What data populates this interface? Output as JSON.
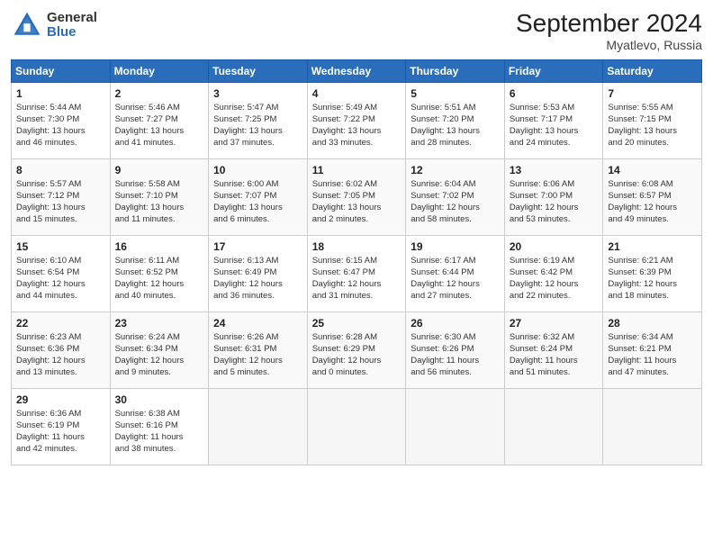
{
  "header": {
    "logo_general": "General",
    "logo_blue": "Blue",
    "month_title": "September 2024",
    "location": "Myatlevo, Russia"
  },
  "weekdays": [
    "Sunday",
    "Monday",
    "Tuesday",
    "Wednesday",
    "Thursday",
    "Friday",
    "Saturday"
  ],
  "weeks": [
    [
      {
        "day": "1",
        "info": "Sunrise: 5:44 AM\nSunset: 7:30 PM\nDaylight: 13 hours\nand 46 minutes."
      },
      {
        "day": "2",
        "info": "Sunrise: 5:46 AM\nSunset: 7:27 PM\nDaylight: 13 hours\nand 41 minutes."
      },
      {
        "day": "3",
        "info": "Sunrise: 5:47 AM\nSunset: 7:25 PM\nDaylight: 13 hours\nand 37 minutes."
      },
      {
        "day": "4",
        "info": "Sunrise: 5:49 AM\nSunset: 7:22 PM\nDaylight: 13 hours\nand 33 minutes."
      },
      {
        "day": "5",
        "info": "Sunrise: 5:51 AM\nSunset: 7:20 PM\nDaylight: 13 hours\nand 28 minutes."
      },
      {
        "day": "6",
        "info": "Sunrise: 5:53 AM\nSunset: 7:17 PM\nDaylight: 13 hours\nand 24 minutes."
      },
      {
        "day": "7",
        "info": "Sunrise: 5:55 AM\nSunset: 7:15 PM\nDaylight: 13 hours\nand 20 minutes."
      }
    ],
    [
      {
        "day": "8",
        "info": "Sunrise: 5:57 AM\nSunset: 7:12 PM\nDaylight: 13 hours\nand 15 minutes."
      },
      {
        "day": "9",
        "info": "Sunrise: 5:58 AM\nSunset: 7:10 PM\nDaylight: 13 hours\nand 11 minutes."
      },
      {
        "day": "10",
        "info": "Sunrise: 6:00 AM\nSunset: 7:07 PM\nDaylight: 13 hours\nand 6 minutes."
      },
      {
        "day": "11",
        "info": "Sunrise: 6:02 AM\nSunset: 7:05 PM\nDaylight: 13 hours\nand 2 minutes."
      },
      {
        "day": "12",
        "info": "Sunrise: 6:04 AM\nSunset: 7:02 PM\nDaylight: 12 hours\nand 58 minutes."
      },
      {
        "day": "13",
        "info": "Sunrise: 6:06 AM\nSunset: 7:00 PM\nDaylight: 12 hours\nand 53 minutes."
      },
      {
        "day": "14",
        "info": "Sunrise: 6:08 AM\nSunset: 6:57 PM\nDaylight: 12 hours\nand 49 minutes."
      }
    ],
    [
      {
        "day": "15",
        "info": "Sunrise: 6:10 AM\nSunset: 6:54 PM\nDaylight: 12 hours\nand 44 minutes."
      },
      {
        "day": "16",
        "info": "Sunrise: 6:11 AM\nSunset: 6:52 PM\nDaylight: 12 hours\nand 40 minutes."
      },
      {
        "day": "17",
        "info": "Sunrise: 6:13 AM\nSunset: 6:49 PM\nDaylight: 12 hours\nand 36 minutes."
      },
      {
        "day": "18",
        "info": "Sunrise: 6:15 AM\nSunset: 6:47 PM\nDaylight: 12 hours\nand 31 minutes."
      },
      {
        "day": "19",
        "info": "Sunrise: 6:17 AM\nSunset: 6:44 PM\nDaylight: 12 hours\nand 27 minutes."
      },
      {
        "day": "20",
        "info": "Sunrise: 6:19 AM\nSunset: 6:42 PM\nDaylight: 12 hours\nand 22 minutes."
      },
      {
        "day": "21",
        "info": "Sunrise: 6:21 AM\nSunset: 6:39 PM\nDaylight: 12 hours\nand 18 minutes."
      }
    ],
    [
      {
        "day": "22",
        "info": "Sunrise: 6:23 AM\nSunset: 6:36 PM\nDaylight: 12 hours\nand 13 minutes."
      },
      {
        "day": "23",
        "info": "Sunrise: 6:24 AM\nSunset: 6:34 PM\nDaylight: 12 hours\nand 9 minutes."
      },
      {
        "day": "24",
        "info": "Sunrise: 6:26 AM\nSunset: 6:31 PM\nDaylight: 12 hours\nand 5 minutes."
      },
      {
        "day": "25",
        "info": "Sunrise: 6:28 AM\nSunset: 6:29 PM\nDaylight: 12 hours\nand 0 minutes."
      },
      {
        "day": "26",
        "info": "Sunrise: 6:30 AM\nSunset: 6:26 PM\nDaylight: 11 hours\nand 56 minutes."
      },
      {
        "day": "27",
        "info": "Sunrise: 6:32 AM\nSunset: 6:24 PM\nDaylight: 11 hours\nand 51 minutes."
      },
      {
        "day": "28",
        "info": "Sunrise: 6:34 AM\nSunset: 6:21 PM\nDaylight: 11 hours\nand 47 minutes."
      }
    ],
    [
      {
        "day": "29",
        "info": "Sunrise: 6:36 AM\nSunset: 6:19 PM\nDaylight: 11 hours\nand 42 minutes."
      },
      {
        "day": "30",
        "info": "Sunrise: 6:38 AM\nSunset: 6:16 PM\nDaylight: 11 hours\nand 38 minutes."
      },
      null,
      null,
      null,
      null,
      null
    ]
  ]
}
